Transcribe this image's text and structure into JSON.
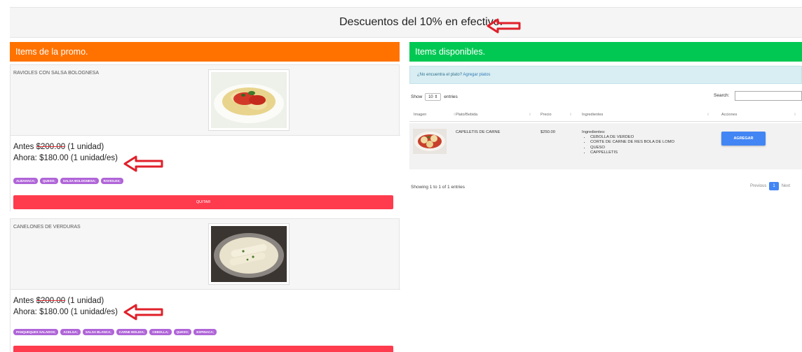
{
  "banner": {
    "text": "Descuentos del 10% en efectivo."
  },
  "promo_panel": {
    "title": "Items de la promo."
  },
  "available_panel": {
    "title": "Items disponibles.",
    "notice_text": "¿No encuentra el plato?",
    "notice_link": "Agregar platos"
  },
  "promo_items": [
    {
      "name": "RAVIOLES CON SALSA BOLOGNESA",
      "before_prefix": "Antes ",
      "before_price": "$200.00",
      "before_suffix": " (1 unidad)",
      "now": "Ahora: $180.00 (1 unidad/es)",
      "tags": [
        "ALBAHACA;",
        "QUESO;",
        "SALSA BOLOGNESA;",
        "RAVIOLES;"
      ],
      "remove_label": "QUITAR"
    },
    {
      "name": "CANELONES DE VERDURAS",
      "before_prefix": "Antes ",
      "before_price": "$200.00",
      "before_suffix": " (1 unidad)",
      "now": "Ahora: $180.00 (1 unidad/es)",
      "tags": [
        "PANQUEQUES SALADOS;",
        "ACELGA;",
        "SALSA BLANCA;",
        "CARNE MOLIDA;",
        "CEBOLLA;",
        "QUESO;",
        "ESPINACA;"
      ],
      "remove_label": ""
    }
  ],
  "table": {
    "show_label": "Show",
    "entries_value": "10",
    "entries_label": "entries",
    "search_label": "Search:",
    "search_value": "",
    "columns": [
      "Imagen",
      "Plato/Bebida",
      "Precio",
      "Ingredientes",
      "Acciones"
    ],
    "rows": [
      {
        "name": "CAPELETIS DE CARNE",
        "price": "$250.00",
        "ingredients_label": "Ingredientes:",
        "ingredients": [
          "CEBOLLA DE VERDEO",
          "CORTE DE CARNE DE RES BOLA DE LOMO",
          "QUESO",
          "CAPPELLETIS"
        ],
        "action_label": "AGREGAR"
      }
    ],
    "info": "Showing 1 to 1 of 1 entries",
    "pager": {
      "previous": "Previous",
      "current": "1",
      "next": "Next"
    }
  },
  "colors": {
    "orange": "#ff7200",
    "green": "#00c853",
    "quitar_red": "#ff3b4e",
    "tag_purple": "#b065d8",
    "agregar_blue": "#4285f4",
    "arrow_red": "#e0202a"
  }
}
